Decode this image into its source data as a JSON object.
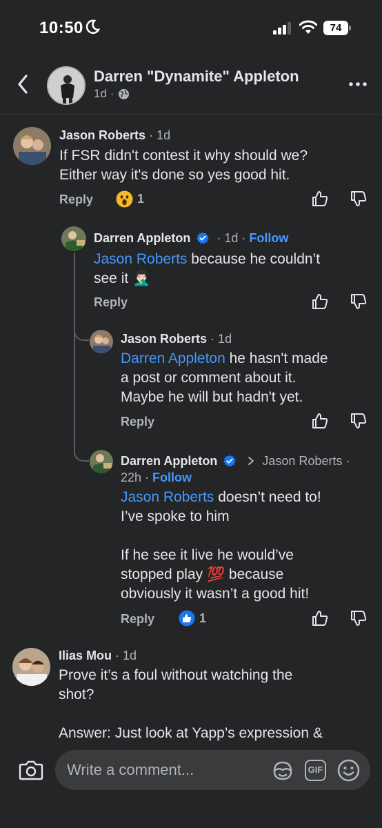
{
  "status": {
    "time": "10:50",
    "battery": "74"
  },
  "header": {
    "name": "Darren \"Dynamite\" Appleton",
    "time": "1d",
    "dot": "·"
  },
  "comments": [
    {
      "name": "Jason Roberts",
      "time": "· 1d",
      "text": [
        "If FSR didn't contest it why should we?",
        "Either way it's done so yes good hit."
      ],
      "reply": "Reply",
      "reaction_count": "1"
    },
    {
      "name": "Darren Appleton",
      "time": "· 1d ·",
      "follow": "Follow",
      "mention": "Jason Roberts",
      "text": [
        " because he couldn’t",
        "see it "
      ],
      "emoji": "🤦🏻‍♂️",
      "reply": "Reply"
    },
    {
      "name": "Jason Roberts",
      "time": "· 1d",
      "mention": "Darren Appleton",
      "text": [
        " he hasn't made",
        "a post or comment about it.",
        "Maybe he will but hadn't yet."
      ],
      "reply": "Reply"
    },
    {
      "name": "Darren Appleton",
      "reply_to": "Jason Roberts ·",
      "time": "22h ·",
      "follow": "Follow",
      "mention": "Jason Roberts",
      "text": [
        " doesn’t need to!",
        "I’ve spoke to him",
        "",
        "If he see it live he would’ve",
        "stopped play ",
        " because",
        "obviously it wasn’t a good hit!"
      ],
      "emoji": "💯",
      "reply": "Reply",
      "reaction_count": "1"
    },
    {
      "name": "Ilias Mou",
      "time": "· 1d",
      "text": [
        "Prove it’s a foul without watching the",
        "shot?",
        "",
        "Answer: Just look at Yapp’s expression &"
      ]
    }
  ],
  "composer": {
    "placeholder": "Write a comment...",
    "gif_label": "GIF"
  },
  "colors": {
    "background": "#242526",
    "link": "#4599ff",
    "muted": "#b0b3b8",
    "text": "#e4e6eb",
    "like_blue": "#1877f2"
  }
}
